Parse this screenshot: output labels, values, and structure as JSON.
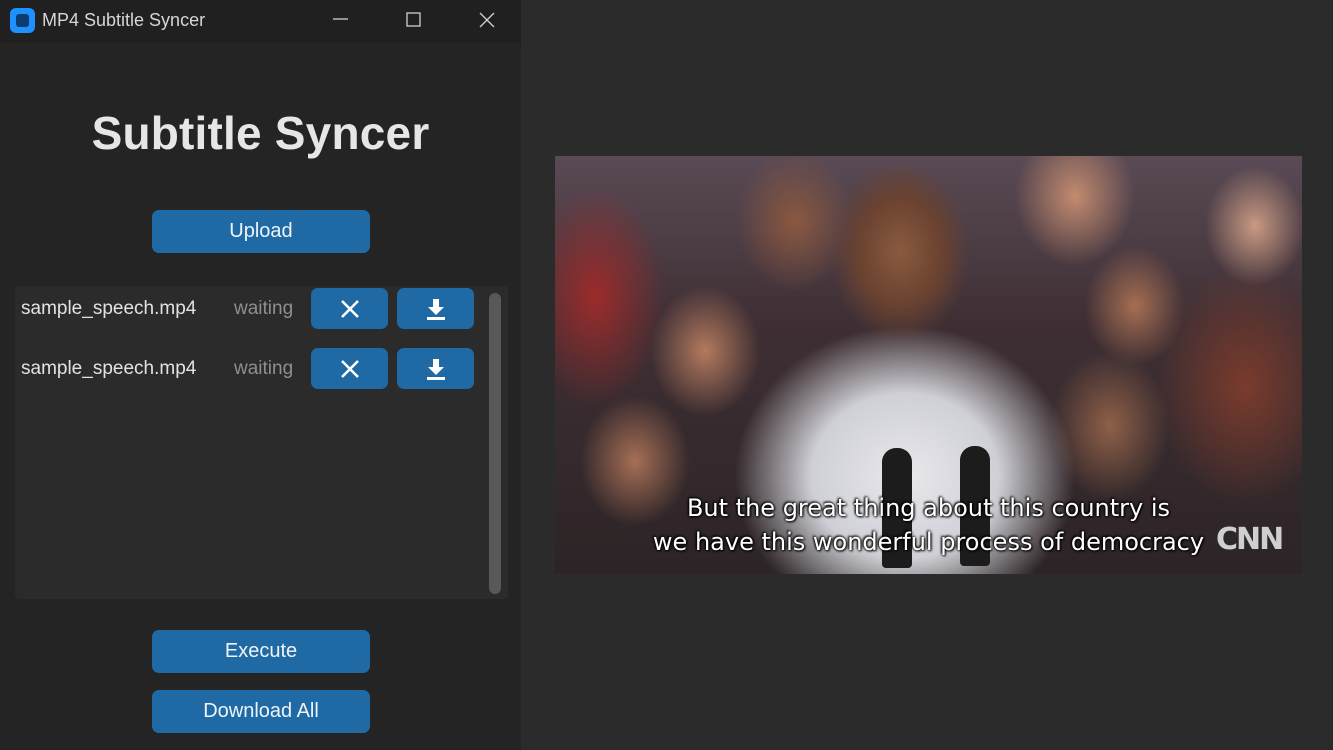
{
  "window": {
    "title": "MP4 Subtitle Syncer"
  },
  "app": {
    "heading": "Subtitle Syncer",
    "upload_label": "Upload",
    "execute_label": "Execute",
    "download_all_label": "Download All"
  },
  "files": [
    {
      "name": "sample_speech.mp4",
      "status": "waiting"
    },
    {
      "name": "sample_speech.mp4",
      "status": "waiting"
    }
  ],
  "video": {
    "subtitle_line1": "But the great thing about this country is",
    "subtitle_line2": "we have this wonderful process of democracy",
    "watermark": "CNN"
  },
  "colors": {
    "accent": "#1f6aa5",
    "background": "#242424",
    "panel": "#2b2b2b"
  },
  "icons": {
    "remove": "close-icon",
    "download": "download-icon",
    "app": "app-icon"
  }
}
